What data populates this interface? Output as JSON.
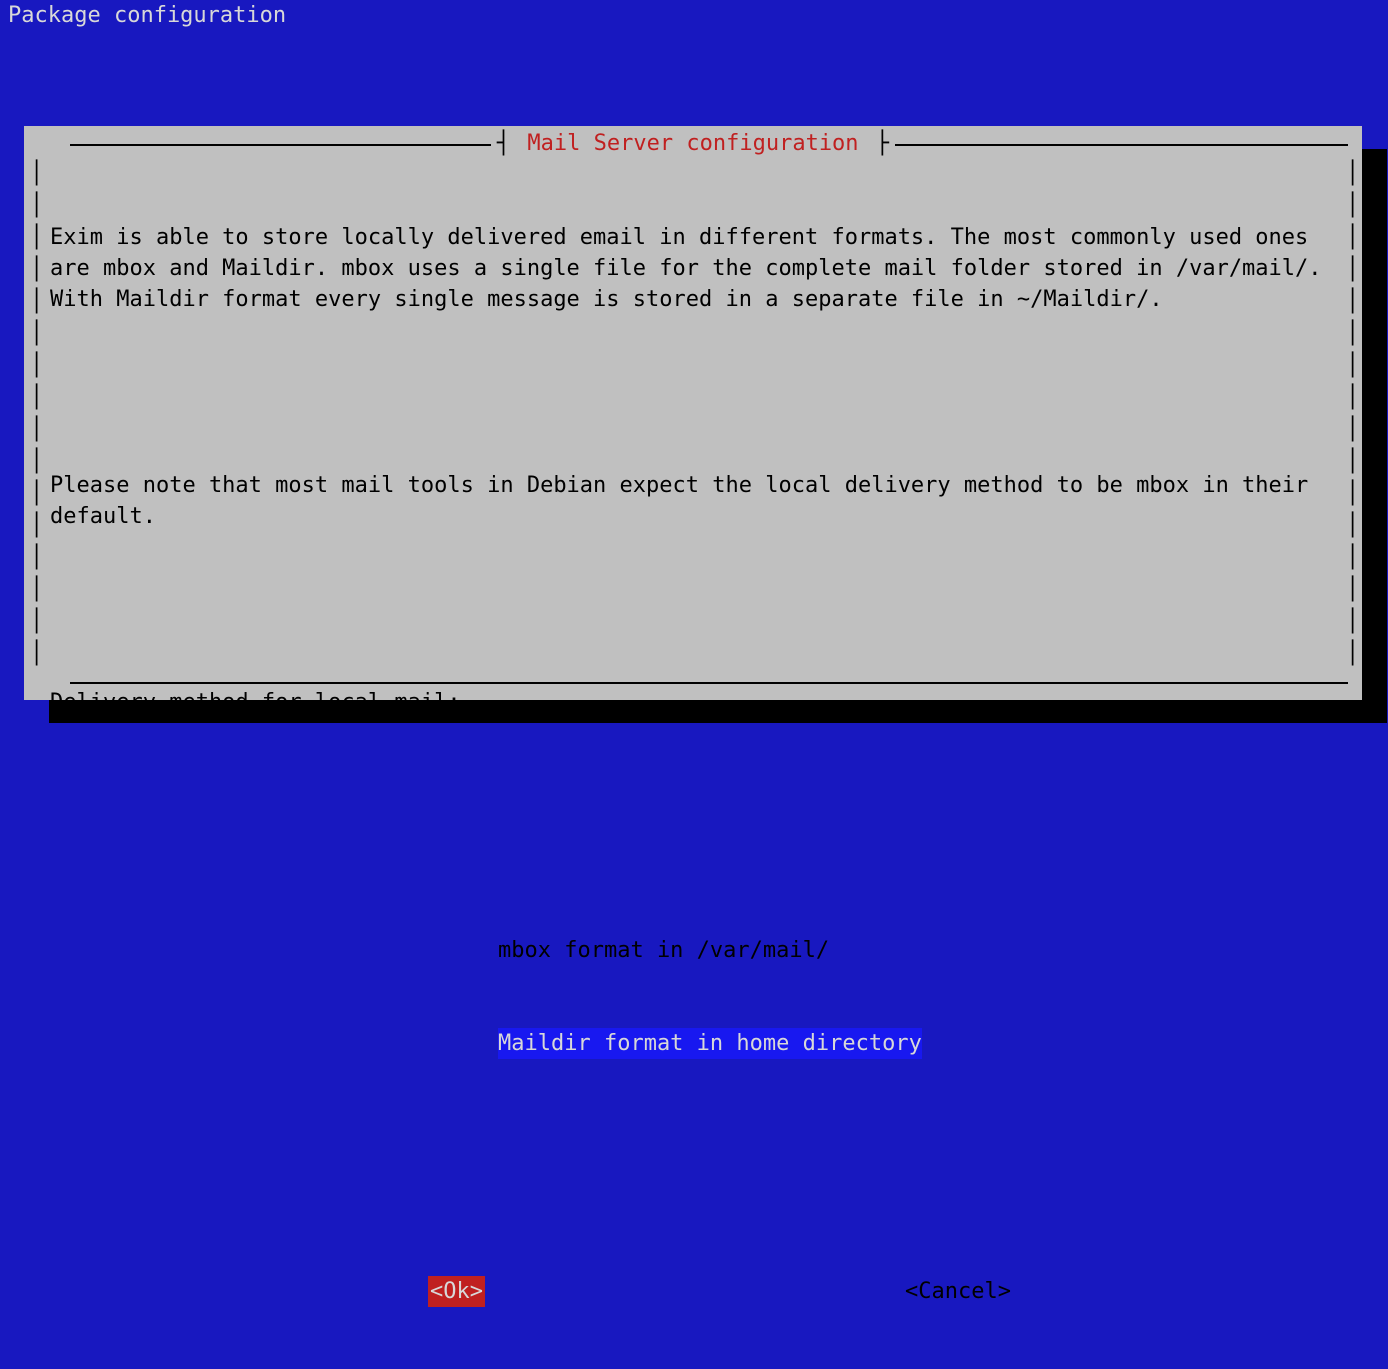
{
  "header": "Package configuration",
  "dialog": {
    "title": "Mail Server configuration",
    "paragraph1": "Exim is able to store locally delivered email in different formats. The most commonly used ones are mbox and Maildir. mbox uses a single file for the complete mail folder stored in /var/mail/. With Maildir format every single message is stored in a separate file in ~/Maildir/.",
    "paragraph2": "Please note that most mail tools in Debian expect the local delivery method to be mbox in their default.",
    "prompt": "Delivery method for local mail:",
    "options": [
      {
        "label": "mbox format in /var/mail/",
        "selected": false
      },
      {
        "label": "Maildir format in home directory",
        "selected": true
      }
    ],
    "buttons": {
      "ok": "<Ok>",
      "cancel": "<Cancel>"
    }
  }
}
